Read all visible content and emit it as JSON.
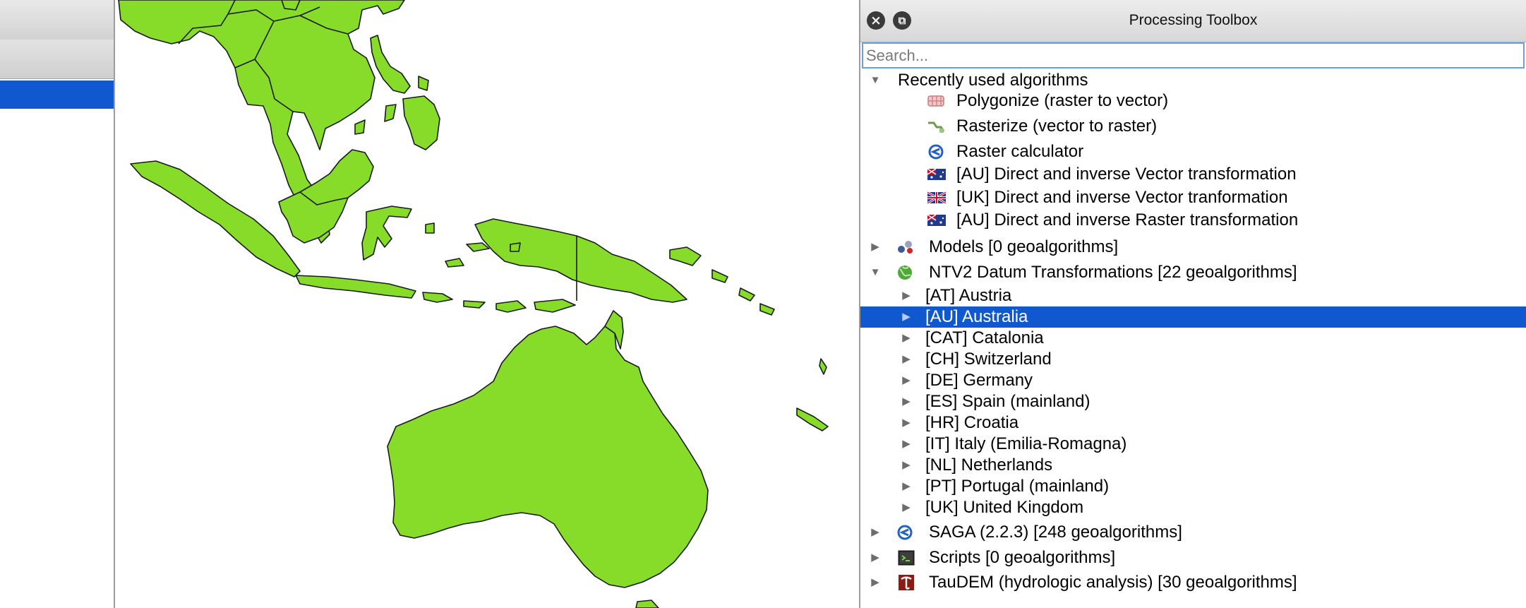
{
  "toolbox": {
    "title": "Processing Toolbox",
    "close_icon": "close-icon",
    "float_icon": "float-icon",
    "search_placeholder": "Search..."
  },
  "tree": {
    "recent": {
      "label": "Recently used algorithms",
      "items": [
        {
          "label": "Polygonize (raster to vector)",
          "icon": "polygonize-icon"
        },
        {
          "label": "Rasterize (vector to raster)",
          "icon": "rasterize-icon"
        },
        {
          "label": "Raster calculator",
          "icon": "saga-icon"
        },
        {
          "label": "[AU] Direct and inverse Vector transformation",
          "icon": "australia-flag-icon"
        },
        {
          "label": "[UK] Direct and inverse Vector tranformation",
          "icon": "uk-flag-icon"
        },
        {
          "label": "[AU] Direct and inverse Raster transformation",
          "icon": "australia-flag-icon"
        }
      ]
    },
    "models": {
      "label": "Models [0 geoalgorithms]",
      "icon": "models-icon"
    },
    "ntv2": {
      "label": "NTV2 Datum Transformations [22 geoalgorithms]",
      "icon": "globe-icon",
      "children": [
        "[AT] Austria",
        "[AU] Australia",
        "[CAT] Catalonia",
        "[CH] Switzerland",
        "[DE] Germany",
        "[ES] Spain (mainland)",
        "[HR] Croatia",
        "[IT] Italy (Emilia-Romagna)",
        "[NL] Netherlands",
        "[PT] Portugal (mainland)",
        "[UK] United Kingdom"
      ],
      "selected": "[AU] Australia"
    },
    "saga": {
      "label": "SAGA (2.2.3) [248 geoalgorithms]",
      "icon": "saga-icon"
    },
    "scripts": {
      "label": "Scripts [0 geoalgorithms]",
      "icon": "terminal-icon"
    },
    "taudem": {
      "label": "TauDEM (hydrologic analysis) [30 geoalgorithms]",
      "icon": "taudem-icon"
    }
  },
  "colors": {
    "selection": "#0f58d0",
    "land": "#86dc29",
    "outline": "#1a1a1a"
  }
}
